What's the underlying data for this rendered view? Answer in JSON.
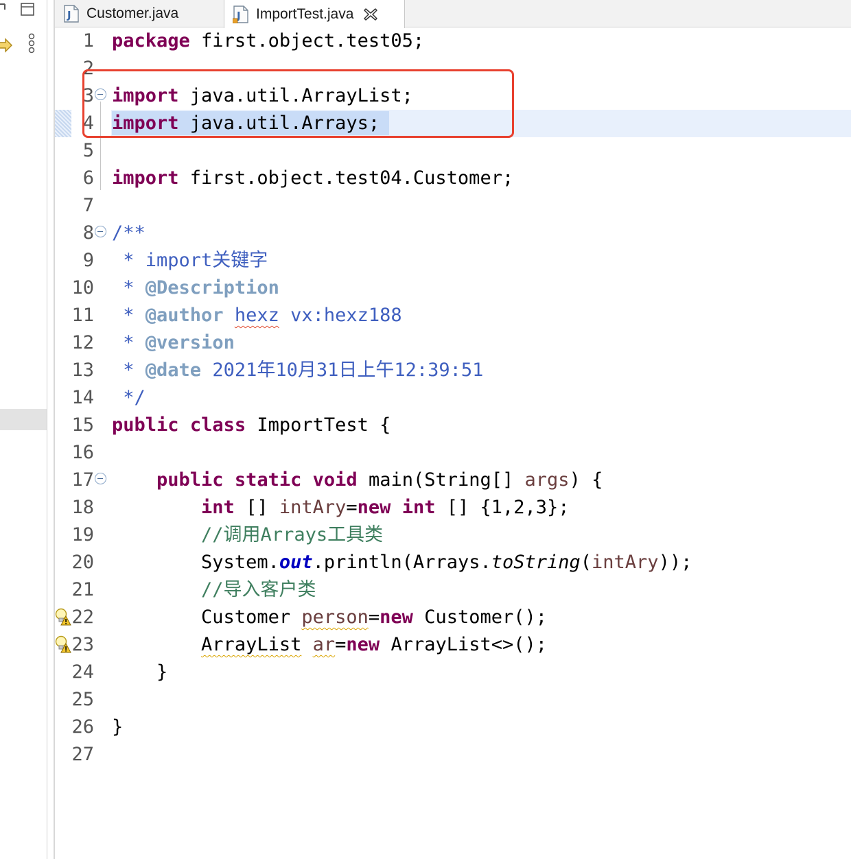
{
  "tabs": [
    {
      "label": "Customer.java",
      "active": false
    },
    {
      "label": "ImportTest.java",
      "active": true
    }
  ],
  "colors": {
    "keyword": "#7f0055",
    "javadoc": "#3f5fbf",
    "comment": "#3f7f5f",
    "field": "#0000c0",
    "local_variable": "#6a3e3e",
    "callout_border": "#e8412f"
  },
  "editor": {
    "highlighted_line": 4,
    "callout_lines": [
      3,
      4
    ],
    "lines": [
      {
        "num": "1",
        "seg": [
          "package",
          " first.object.test05;"
        ]
      },
      {
        "num": "2",
        "seg": []
      },
      {
        "num": "3",
        "seg": [
          "import",
          " java.util.ArrayList;"
        ]
      },
      {
        "num": "4",
        "seg": [
          "import",
          " java.util.Arrays;"
        ]
      },
      {
        "num": "5",
        "seg": []
      },
      {
        "num": "6",
        "seg": [
          "import",
          " first.object.test04.Customer;"
        ]
      },
      {
        "num": "7",
        "seg": []
      },
      {
        "num": "8",
        "seg": [
          "/**"
        ]
      },
      {
        "num": "9",
        "seg": [
          " * import关键字"
        ]
      },
      {
        "num": "10",
        "seg": [
          " * ",
          "@Description"
        ]
      },
      {
        "num": "11",
        "seg": [
          " * ",
          "@author",
          " ",
          "hexz",
          " vx:hexz188"
        ]
      },
      {
        "num": "12",
        "seg": [
          " * ",
          "@version"
        ]
      },
      {
        "num": "13",
        "seg": [
          " * ",
          "@date",
          " 2021年10月31日上午12:39:51"
        ]
      },
      {
        "num": "14",
        "seg": [
          " */"
        ]
      },
      {
        "num": "15",
        "seg": [
          "public",
          " ",
          "class",
          " ImportTest {"
        ]
      },
      {
        "num": "16",
        "seg": []
      },
      {
        "num": "17",
        "seg": [
          "    ",
          "public",
          " ",
          "static",
          " ",
          "void",
          " main(String[] ",
          "args",
          ") {"
        ]
      },
      {
        "num": "18",
        "seg": [
          "        ",
          "int",
          " [] ",
          "intAry",
          "=",
          "new",
          " ",
          "int",
          " [] {1,2,3};"
        ]
      },
      {
        "num": "19",
        "seg": [
          "        ",
          "//调用Arrays工具类"
        ]
      },
      {
        "num": "20",
        "seg": [
          "        System.",
          "out",
          ".println(Arrays.",
          "toString",
          "(",
          "intAry",
          "));"
        ]
      },
      {
        "num": "21",
        "seg": [
          "        ",
          "//导入客户类"
        ]
      },
      {
        "num": "22",
        "seg": [
          "        Customer ",
          "person",
          "=",
          "new",
          " Customer();"
        ]
      },
      {
        "num": "23",
        "seg": [
          "        ",
          "ArrayList",
          " ",
          "ar",
          "=",
          "new",
          " ArrayList<>();"
        ]
      },
      {
        "num": "24",
        "seg": [
          "    }"
        ]
      },
      {
        "num": "25",
        "seg": []
      },
      {
        "num": "26",
        "seg": [
          "}"
        ]
      },
      {
        "num": "27",
        "seg": []
      }
    ]
  }
}
